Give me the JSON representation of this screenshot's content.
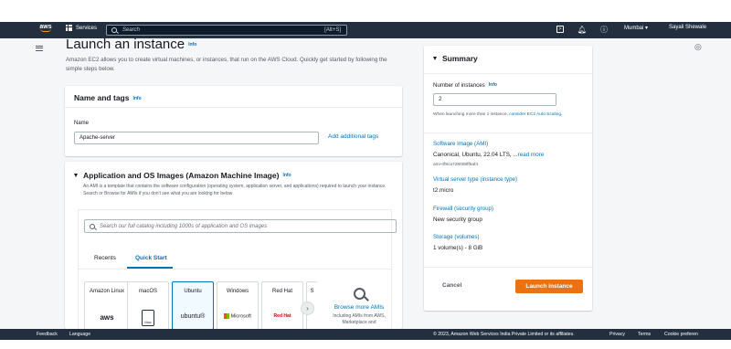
{
  "topnav": {
    "logo": "aws",
    "services_label": "Services",
    "search_placeholder": "Search",
    "search_shortcut": "[Alt+S]",
    "region": "Mumbai ▾",
    "user": "Sayali Shewale"
  },
  "page": {
    "title": "Launch an instance",
    "title_info": "Info",
    "subtitle": "Amazon EC2 allows you to create virtual machines, or instances, that run on the AWS Cloud. Quickly get started by following the simple steps below."
  },
  "name_tags": {
    "header": "Name and tags",
    "info": "Info",
    "name_label": "Name",
    "name_value": "Apache-server",
    "add_tags": "Add additional tags"
  },
  "ami": {
    "header": "Application and OS Images (Amazon Machine Image)",
    "info": "Info",
    "description": "An AMI is a template that contains the software configuration (operating system, application server, and applications) required to launch your instance. Search or Browse for AMIs if you don't see what you are looking for below",
    "search_placeholder": "Search our full catalog including 1000s of application and OS images",
    "tabs": [
      "Recents",
      "Quick Start"
    ],
    "tiles": [
      {
        "name": "Amazon Linux",
        "logo": "aws"
      },
      {
        "name": "macOS",
        "logo": "Mac"
      },
      {
        "name": "Ubuntu",
        "logo": "ubuntu®"
      },
      {
        "name": "Windows",
        "logo": "Microsoft"
      },
      {
        "name": "Red Hat",
        "logo": "Red Hat"
      },
      {
        "name": "S",
        "logo": ""
      }
    ],
    "browse_label": "Browse more AMIs",
    "browse_sub": "Including AMIs from AWS, Marketplace and"
  },
  "summary": {
    "header": "Summary",
    "instances_label": "Number of instances",
    "instances_info": "Info",
    "instances_value": "2",
    "instances_note_pre": "When launching more than 1 instance, ",
    "instances_note_link": "consider EC2 Auto Scaling.",
    "software_image_label": "Software Image (AMI)",
    "software_image_value": "Canonical, Ubuntu, 22.04 LTS, ...",
    "read_more": "read more",
    "ami_id": "ami-0f8ca728008ff5af4",
    "server_type_label": "Virtual server type (instance type)",
    "server_type_value": "t2.micro",
    "firewall_label": "Firewall (security group)",
    "firewall_value": "New security group",
    "storage_label": "Storage (volumes)",
    "storage_value": "1 volume(s) - 8 GiB",
    "cancel": "Cancel",
    "launch": "Launch instance"
  },
  "footer": {
    "feedback": "Feedback",
    "language": "Language",
    "copyright": "© 2023, Amazon Web Services India Private Limited or its affiliates.",
    "privacy": "Privacy",
    "terms": "Terms",
    "cookie": "Cookie preferen"
  }
}
